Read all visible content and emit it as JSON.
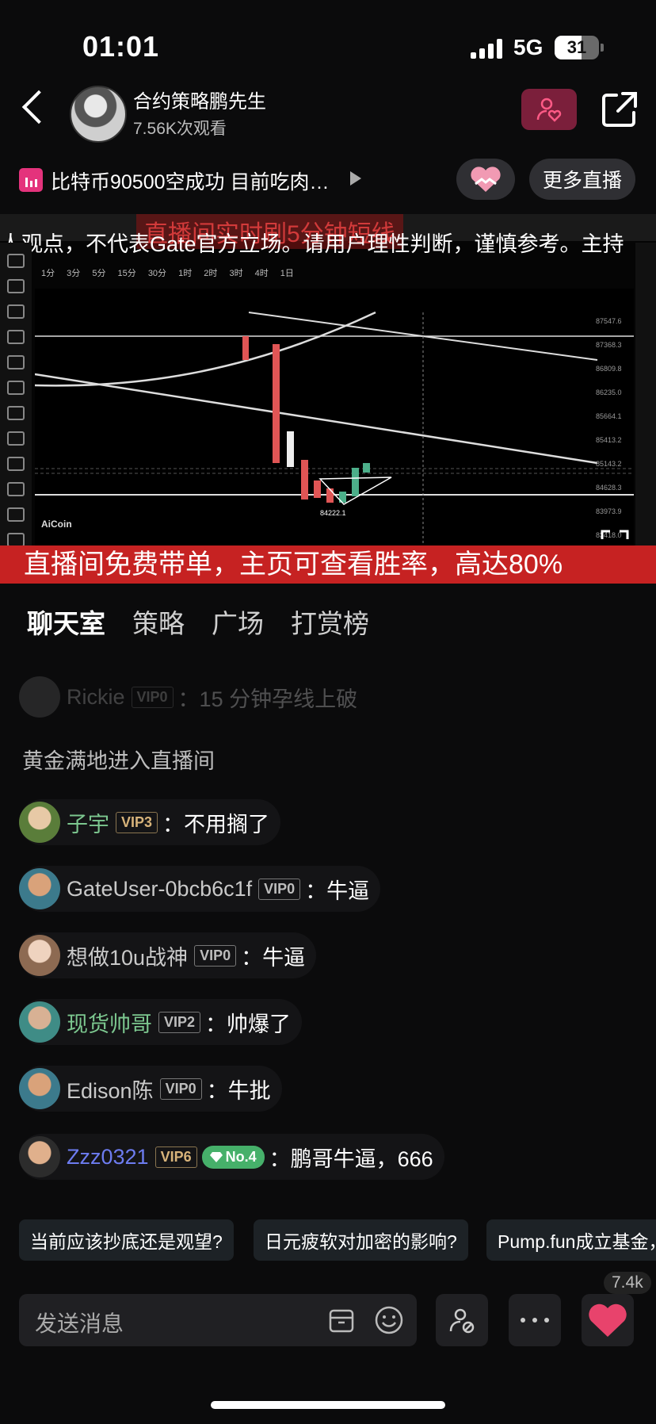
{
  "status_bar": {
    "time": "01:01",
    "network": "5G",
    "battery": "31"
  },
  "header": {
    "host_name": "合约策略鹏先生",
    "views": "7.56K次观看"
  },
  "title_row": {
    "stream_title": "比特币90500空成功 目前吃肉…",
    "more_live": "更多直播"
  },
  "video": {
    "ticker": "人观点，不代表Gate官方立场。请用户理性判断，谨慎参考。主持",
    "overlay_heading": "直播间实时刷5分钟短线",
    "banner": "直播间免费带单，主页可查看胜率，高达80%",
    "watermark": "AiCoin",
    "timeframes": "1分 3分 5分 15分 30分 1时 2时 3时 4时 1日",
    "prices": [
      "87547.6",
      "87368.3",
      "86809.8",
      "86235.0",
      "85664.1",
      "85413.2",
      "85143.2",
      "84628.3",
      "83973.9",
      "83418.0"
    ],
    "low_label": "84222.1"
  },
  "tabs": [
    {
      "label": "聊天室"
    },
    {
      "label": "策略"
    },
    {
      "label": "广场"
    },
    {
      "label": "打赏榜"
    }
  ],
  "chat": {
    "faded": {
      "name": "Rickie",
      "vip": "VIP0",
      "msg": "：15 分钟孕线上破"
    },
    "system": "黄金满地进入直播间",
    "messages": [
      {
        "name": "子宇",
        "vip": "VIP3",
        "msg": "：不用搁了",
        "name_color": "#7cc78f"
      },
      {
        "name": "GateUser-0bcb6c1f",
        "vip": "VIP0",
        "msg": "：牛逼",
        "name_color": "#c9c9c9"
      },
      {
        "name": "想做10u战神",
        "vip": "VIP0",
        "msg": "：牛逼",
        "name_color": "#c9c9c9"
      },
      {
        "name": "现货帅哥",
        "vip": "VIP2",
        "msg": "：帅爆了",
        "name_color": "#7cc78f"
      },
      {
        "name": "Edison陈",
        "vip": "VIP0",
        "msg": "：牛批",
        "name_color": "#c9c9c9"
      },
      {
        "name": "Zzz0321",
        "vip": "VIP6",
        "rank": "No.4",
        "msg": "：鹏哥牛逼，666",
        "name_color": "#6d7cf0"
      }
    ]
  },
  "suggestions": [
    "当前应该抄底还是观望?",
    "日元疲软对加密的影响?",
    "Pump.fun成立基金，"
  ],
  "input": {
    "placeholder": "发送消息",
    "likes": "7.4k"
  },
  "colors": {
    "background": "#0b0b0c",
    "banner_red": "#c62222",
    "follow_bg": "#7b1f3b",
    "heart": "#e8436c"
  }
}
